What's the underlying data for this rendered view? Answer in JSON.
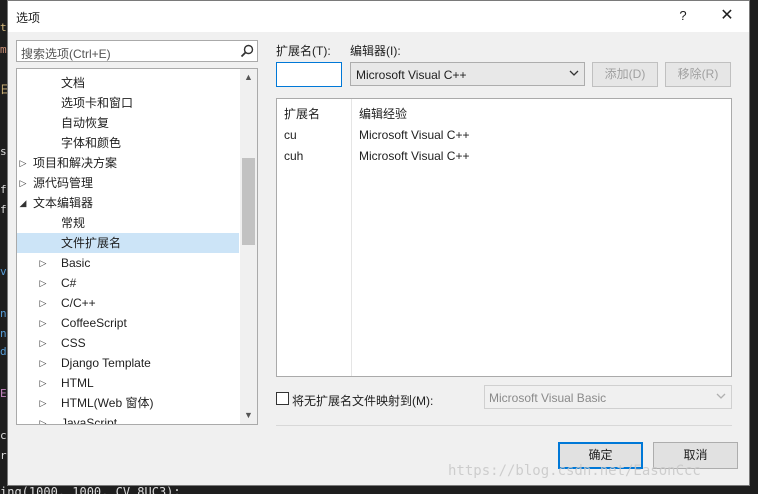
{
  "dialog": {
    "title": "选项",
    "help_label": "?",
    "close_label": "✕"
  },
  "search": {
    "placeholder": "搜索选项(Ctrl+E)"
  },
  "tree": {
    "items": [
      {
        "label": "文档",
        "toggle": "",
        "indent": 2
      },
      {
        "label": "选项卡和窗口",
        "toggle": "",
        "indent": 2
      },
      {
        "label": "自动恢复",
        "toggle": "",
        "indent": 2
      },
      {
        "label": "字体和颜色",
        "toggle": "",
        "indent": 2
      },
      {
        "label": "项目和解决方案",
        "toggle": "▷",
        "indent": 1
      },
      {
        "label": "源代码管理",
        "toggle": "▷",
        "indent": 1
      },
      {
        "label": "文本编辑器",
        "toggle": "◢",
        "indent": 1
      },
      {
        "label": "常规",
        "toggle": "",
        "indent": 2
      },
      {
        "label": "文件扩展名",
        "toggle": "",
        "indent": 2,
        "selected": true
      },
      {
        "label": "Basic",
        "toggle": "▷",
        "indent": 2
      },
      {
        "label": "C#",
        "toggle": "▷",
        "indent": 2
      },
      {
        "label": "C/C++",
        "toggle": "▷",
        "indent": 2
      },
      {
        "label": "CoffeeScript",
        "toggle": "▷",
        "indent": 2
      },
      {
        "label": "CSS",
        "toggle": "▷",
        "indent": 2
      },
      {
        "label": "Django Template",
        "toggle": "▷",
        "indent": 2
      },
      {
        "label": "HTML",
        "toggle": "▷",
        "indent": 2
      },
      {
        "label": "HTML(Web 窗体)",
        "toggle": "▷",
        "indent": 2
      },
      {
        "label": "JavaScript",
        "toggle": "▷",
        "indent": 2
      }
    ]
  },
  "extension": {
    "label": "扩展名(T):",
    "value": ""
  },
  "editor": {
    "label": "编辑器(I):",
    "selected": "Microsoft Visual C++"
  },
  "buttons": {
    "add": "添加(D)",
    "remove": "移除(R)",
    "ok": "确定",
    "cancel": "取消"
  },
  "ext_table": {
    "headers": [
      "扩展名",
      "编辑经验"
    ],
    "rows": [
      [
        "cu",
        "Microsoft Visual C++"
      ],
      [
        "cuh",
        "Microsoft Visual C++"
      ]
    ]
  },
  "mapping": {
    "checkbox_label": "将无扩展名文件映射到(M):",
    "checked": false,
    "selected": "Microsoft Visual Basic"
  },
  "watermark": "https://blog.csdn.net/EasonCcc",
  "background_code": {
    "left_chars": [
      "t",
      "m",
      "日",
      "s",
      "f",
      "f",
      "v",
      "n",
      "n",
      "d",
      "E",
      "c",
      "r"
    ],
    "bottom_line": "ing(1000, 1000, CV_8UC3);"
  },
  "colors": {
    "selection": "#cce4f7",
    "accent": "#0078d7",
    "dialog_bg": "#f0f0f0"
  }
}
